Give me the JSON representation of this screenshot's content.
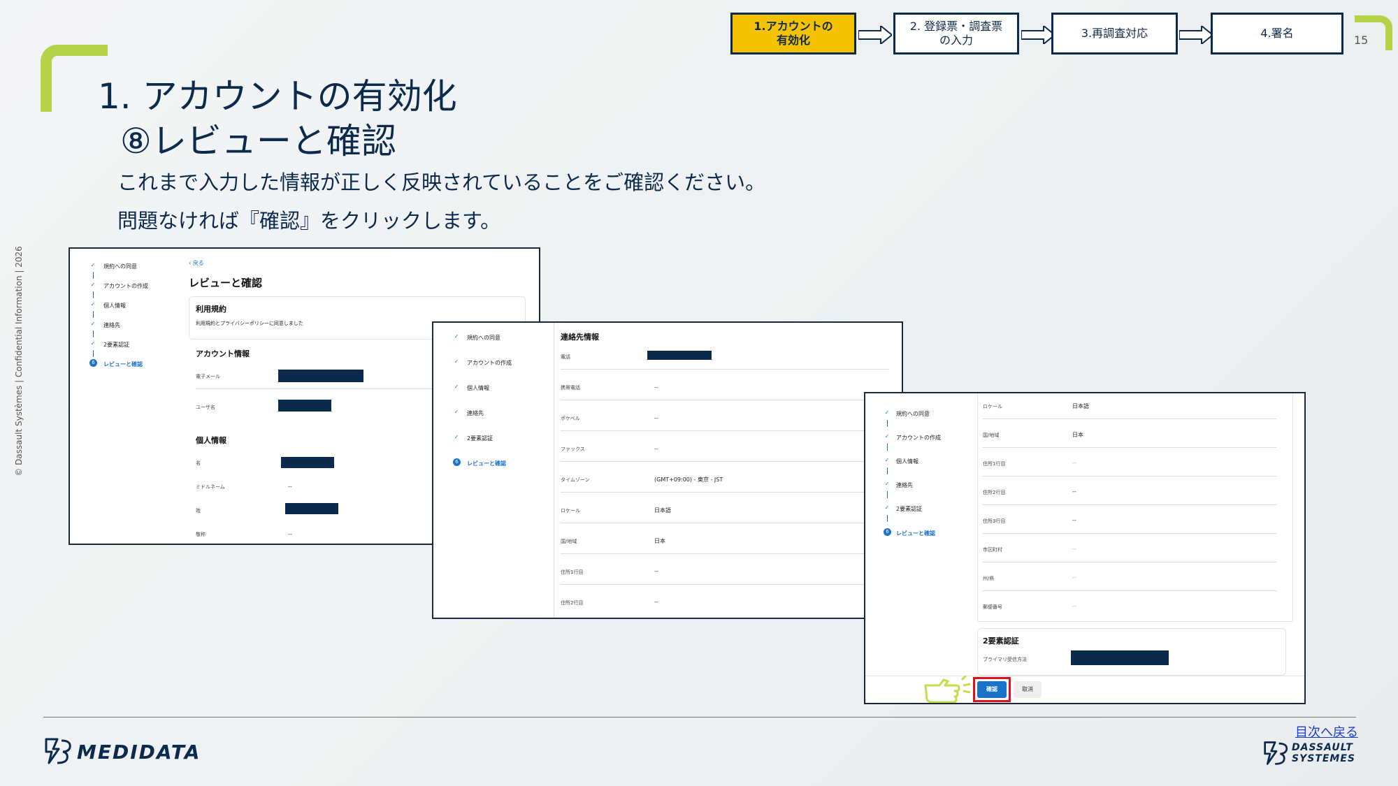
{
  "page_number": "15",
  "steps": [
    {
      "label": "1.アカウントの\n有効化",
      "active": true
    },
    {
      "label": "2. 登録票・調査票\nの入力",
      "active": false
    },
    {
      "label": "3.再調査対応",
      "active": false
    },
    {
      "label": "4.署名",
      "active": false
    }
  ],
  "title": {
    "line1": "1. アカウントの有効化",
    "line2": "⑧レビューと確認"
  },
  "body": {
    "line1": "これまで入力した情報が正しく反映されていることをご確認ください。",
    "line2": "問題なければ『確認』をクリックします。"
  },
  "copyright": "© Dassault Systèmes | Confidential Information | 2026",
  "sidebar": {
    "items": [
      "規約への同意",
      "アカウントの作成",
      "個人情報",
      "連絡先",
      "2要素認証",
      "レビューと確認"
    ]
  },
  "shot1": {
    "back": "戻る",
    "heading": "レビューと確認",
    "terms_title": "利用規約",
    "terms_text": "利用規約とプライバシーポリシーに同意しました",
    "account_title": "アカウント情報",
    "email_label": "電子メール",
    "user_label": "ユーザ名",
    "personal_title": "個人情報",
    "first_label": "名",
    "middle_label": "ミドルネーム",
    "middle_value": "--",
    "last_label": "姓",
    "title_label": "敬称",
    "title_value": "--"
  },
  "shot2": {
    "heading": "連絡先情報",
    "rows": [
      {
        "label": "電話",
        "value": ""
      },
      {
        "label": "携帯電話",
        "value": "--"
      },
      {
        "label": "ポケベル",
        "value": "--"
      },
      {
        "label": "ファックス",
        "value": "--"
      },
      {
        "label": "タイムゾーン",
        "value": "(GMT+09:00) - 東京 - JST"
      },
      {
        "label": "ロケール",
        "value": "日本語"
      },
      {
        "label": "国/地域",
        "value": "日本"
      },
      {
        "label": "住所1行目",
        "value": "--"
      },
      {
        "label": "住所2行目",
        "value": "--"
      }
    ]
  },
  "shot3": {
    "rows": [
      {
        "label": "ロケール",
        "value": "日本語"
      },
      {
        "label": "国/地域",
        "value": "日本"
      },
      {
        "label": "住所1行目",
        "value": "--"
      },
      {
        "label": "住所2行目",
        "value": "--"
      },
      {
        "label": "住所3行目",
        "value": "--"
      },
      {
        "label": "市区町村",
        "value": "--"
      },
      {
        "label": "州/県",
        "value": "--"
      },
      {
        "label": "郵便番号",
        "value": "--"
      }
    ],
    "twofa_title": "2要素認証",
    "twofa_label": "プライマリ受信方法",
    "confirm": "確認",
    "cancel": "取消"
  },
  "footer": {
    "brand": "MEDIDATA",
    "back_link": "目次へ戻る",
    "ds_line1": "DASSAULT",
    "ds_line2": "SYSTEMES"
  }
}
